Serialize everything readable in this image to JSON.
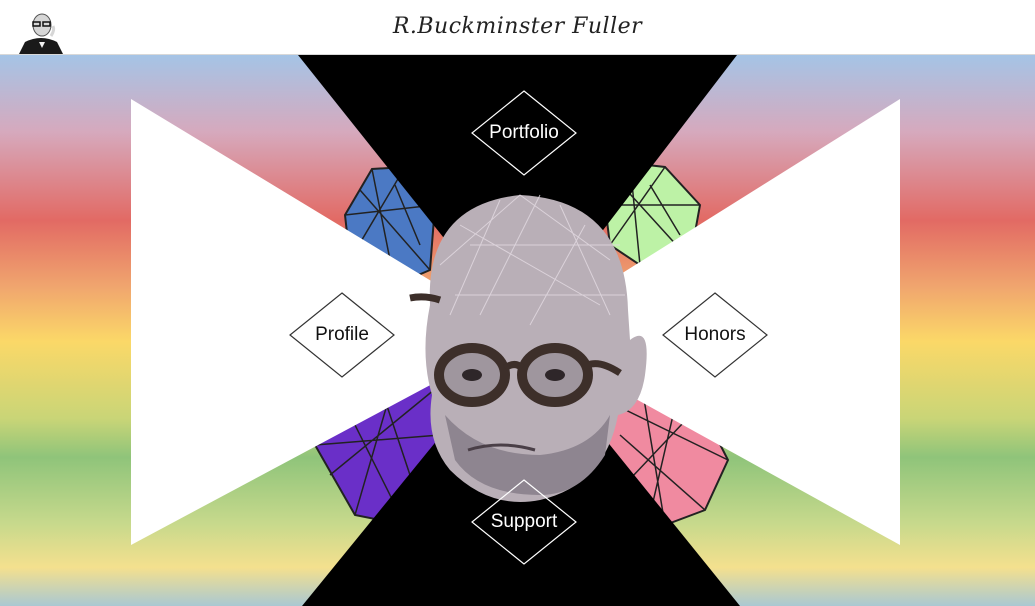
{
  "header": {
    "title": "R.Buckminster Fuller",
    "avatar_icon": "fuller-portrait-thumbnail"
  },
  "nav": {
    "portfolio": "Portfolio",
    "profile": "Profile",
    "honors": "Honors",
    "support": "Support"
  },
  "hero": {
    "image_icon": "geodesic-head-portrait"
  },
  "colors": {
    "dark_wedge": "#000000",
    "light_wedge": "#ffffff",
    "dome_blue": "#4b79c4",
    "dome_green": "#bdf2a6",
    "dome_purple": "#6a2fc8",
    "dome_pink": "#f08aa0"
  }
}
